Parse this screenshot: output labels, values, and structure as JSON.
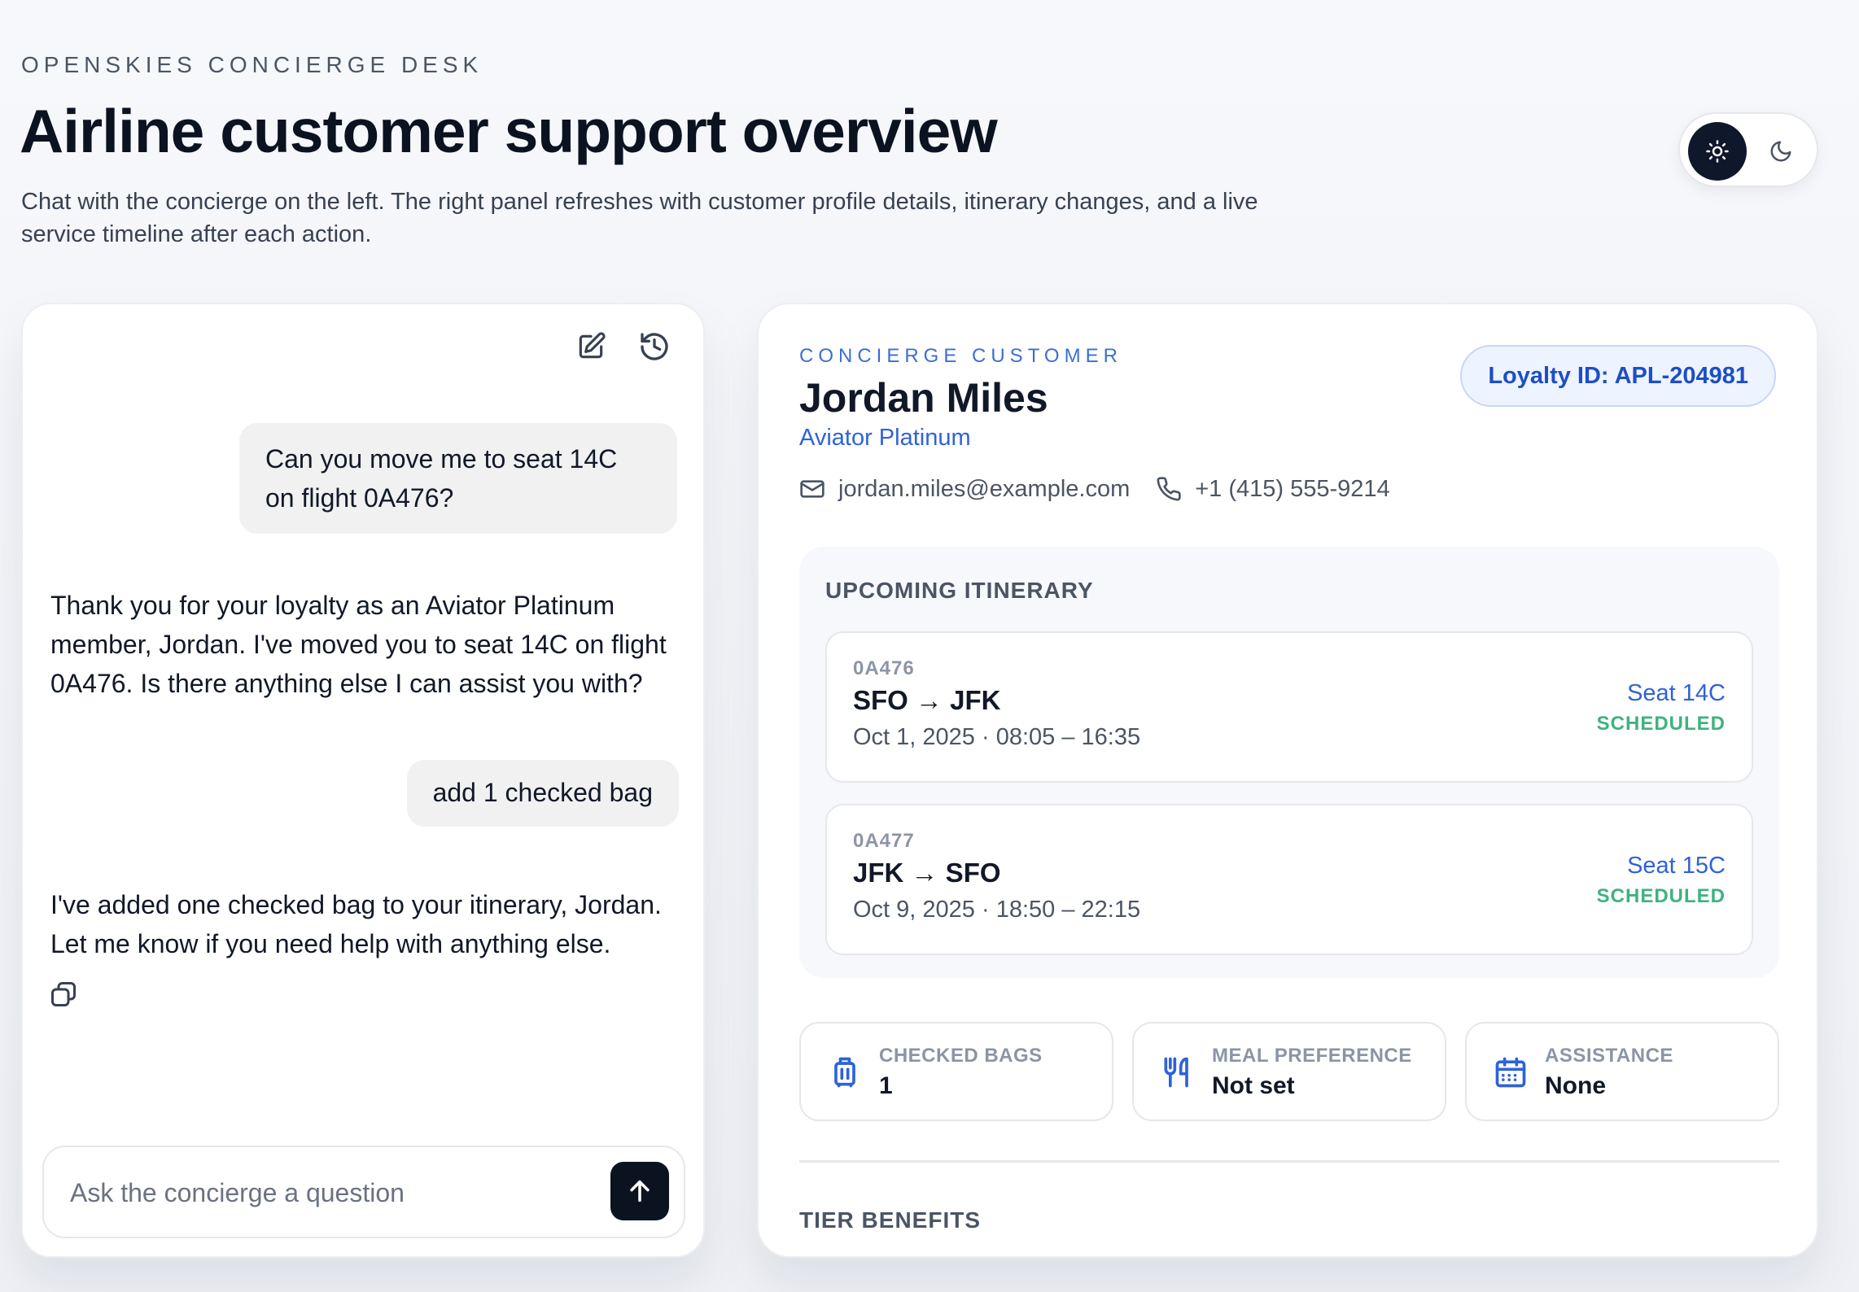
{
  "header": {
    "eyebrow": "OPENSKIES CONCIERGE DESK",
    "title": "Airline customer support overview",
    "subtitle": "Chat with the concierge on the left. The right panel refreshes with customer profile details, itinerary changes, and a live service timeline after each action."
  },
  "theme_toggle": {
    "light_icon": "sun-icon",
    "dark_icon": "moon-icon"
  },
  "chat": {
    "tools": [
      "edit-icon",
      "history-icon"
    ],
    "messages": [
      {
        "role": "user",
        "text": "Can you move me to seat 14C on flight 0A476?"
      },
      {
        "role": "assistant",
        "text": "Thank you for your loyalty as an Aviator Platinum member, Jordan. I've moved you to seat 14C on flight 0A476. Is there anything else I can assist you with?"
      },
      {
        "role": "user",
        "text": "add 1 checked bag"
      },
      {
        "role": "assistant",
        "text": "I've added one checked bag to your itinerary, Jordan. Let me know if you need help with anything else."
      }
    ],
    "composer": {
      "placeholder": "Ask the concierge a question",
      "send_icon": "arrow-up-icon"
    }
  },
  "customer": {
    "eyebrow": "CONCIERGE CUSTOMER",
    "name": "Jordan Miles",
    "tier": "Aviator Platinum",
    "email": "jordan.miles@example.com",
    "phone": "+1 (415) 555-9214",
    "loyalty_id": "Loyalty ID: APL-204981"
  },
  "itinerary": {
    "title": "UPCOMING ITINERARY",
    "flights": [
      {
        "code": "0A476",
        "route": "SFO → JFK",
        "time": "Oct 1, 2025 · 08:05 – 16:35",
        "seat": "Seat 14C",
        "status": "SCHEDULED"
      },
      {
        "code": "0A477",
        "route": "JFK → SFO",
        "time": "Oct 9, 2025 · 18:50 – 22:15",
        "seat": "Seat 15C",
        "status": "SCHEDULED"
      }
    ]
  },
  "stats": [
    {
      "label": "CHECKED BAGS",
      "value": "1",
      "icon": "luggage-icon"
    },
    {
      "label": "MEAL PREFERENCE",
      "value": "Not set",
      "icon": "utensils-icon"
    },
    {
      "label": "ASSISTANCE",
      "value": "None",
      "icon": "calendar-icon"
    }
  ],
  "tier_benefits": {
    "title": "TIER BENEFITS"
  },
  "colors": {
    "accent": "#2f63d6",
    "status_green": "#3fb27f",
    "dark": "#0b1220"
  }
}
